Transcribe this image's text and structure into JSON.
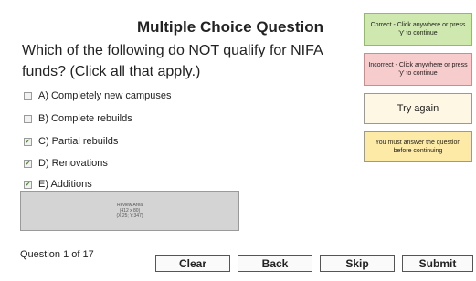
{
  "title": "Multiple Choice Question",
  "question": "Which of the following do NOT qualify for NIFA funds?  (Click all that apply.)",
  "options": [
    {
      "label": "A) Completely new campuses",
      "checked": false
    },
    {
      "label": "B) Complete rebuilds",
      "checked": false
    },
    {
      "label": "C) Partial rebuilds",
      "checked": true
    },
    {
      "label": "D) Renovations",
      "checked": true
    },
    {
      "label": "E) Additions",
      "checked": true
    }
  ],
  "review_area": {
    "line1": "Review Area",
    "line2": "(412 x 80)",
    "line3": "(X:25; Y:347)"
  },
  "counter": "Question 1 of 17",
  "buttons": {
    "clear": "Clear",
    "back": "Back",
    "skip": "Skip",
    "submit": "Submit"
  },
  "feedback": {
    "correct": "Correct - Click anywhere or press 'y' to continue",
    "incorrect": "Incorrect - Click anywhere or press 'y' to continue",
    "try_again": "Try again",
    "must_answer": "You must answer the question before continuing"
  },
  "colors": {
    "correct_bg": "#cfe8b0",
    "correct_border": "#8fbf5a",
    "incorrect_bg": "#f6cccc",
    "incorrect_border": "#d08a8a",
    "tryagain_bg": "#fdf7e4",
    "mustanswer_bg": "#fdeaa6",
    "check_mark": "#4a8a2a"
  },
  "icons": {
    "checked": "check-icon"
  }
}
